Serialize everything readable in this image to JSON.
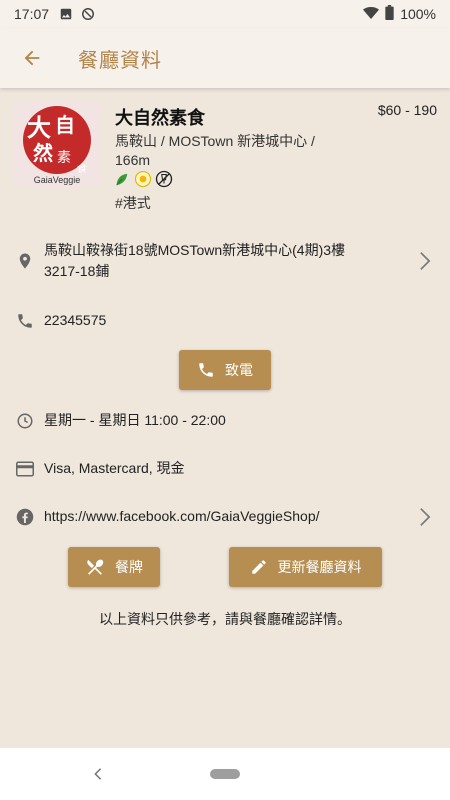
{
  "status_bar": {
    "time": "17:07",
    "battery": "100%"
  },
  "app_bar": {
    "title": "餐廳資料"
  },
  "restaurant": {
    "logo_text": "大自然素食",
    "logo_brand": "GaiaVeggie",
    "name": "大自然素食",
    "price": "$60 - 190",
    "location": "馬鞍山 / MOSTown 新港城中心 / 166m",
    "diet_icons": [
      "vegan-leaf-icon",
      "egg-icon",
      "no-alcohol-icon"
    ],
    "cuisine": "#港式"
  },
  "address": "馬鞍山鞍祿街18號MOSTown新港城中心(4期)3樓3217-18鋪",
  "phone": "22345575",
  "call_button": "致電",
  "hours": "星期一 - 星期日 11:00 - 22:00",
  "payment": "Visa, Mastercard, 現金",
  "website": "https://www.facebook.com/GaiaVeggieShop/",
  "menu_button": "餐牌",
  "update_button": "更新餐廳資料",
  "disclaimer": "以上資料只供參考，請與餐廳確認詳情。",
  "colors": {
    "accent": "#b3844a",
    "button": "#b68e52",
    "background": "#efe6dc",
    "appbar": "#f6f1ea"
  }
}
